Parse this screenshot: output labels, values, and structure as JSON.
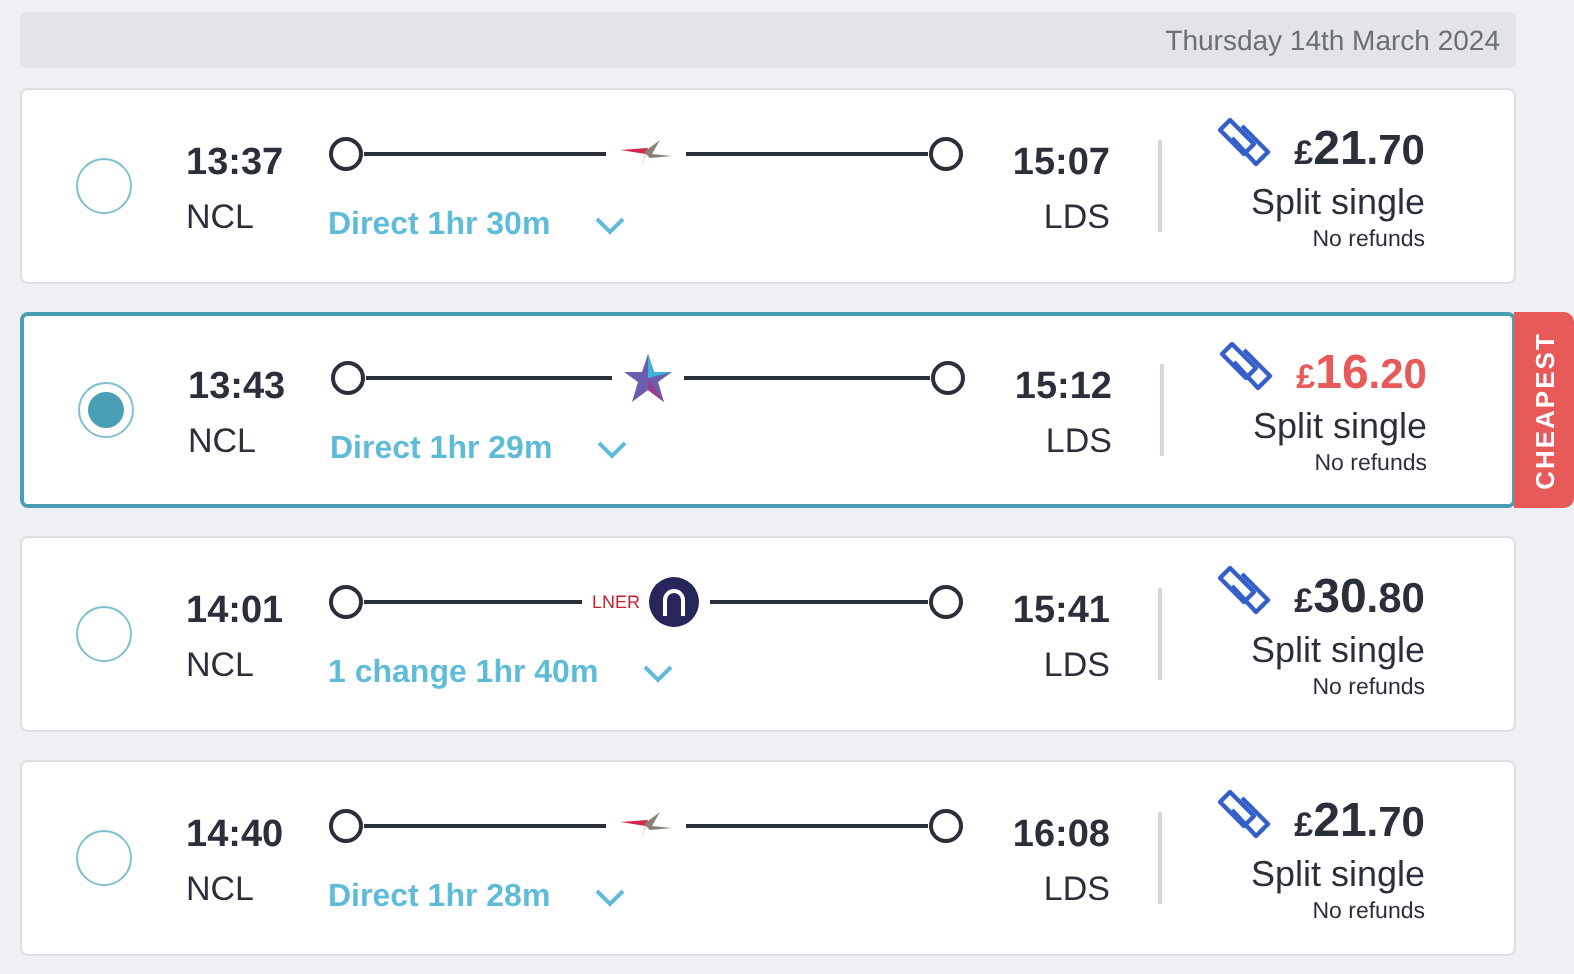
{
  "date": "Thursday 14th March 2024",
  "journeys": [
    {
      "selected": false,
      "cheapest": false,
      "depart": "13:37",
      "from": "NCL",
      "arrive": "15:07",
      "to": "LDS",
      "operator": {
        "kind": "bird"
      },
      "summary": "Direct 1hr 30m",
      "currency": "£",
      "pounds": "21",
      "pence": ".70",
      "fare": "Split single",
      "conditions": "No refunds"
    },
    {
      "selected": true,
      "cheapest": true,
      "badge": "CHEAPEST",
      "depart": "13:43",
      "from": "NCL",
      "arrive": "15:12",
      "to": "LDS",
      "operator": {
        "kind": "star"
      },
      "summary": "Direct 1hr 29m",
      "currency": "£",
      "pounds": "16",
      "pence": ".20",
      "fare": "Split single",
      "conditions": "No refunds"
    },
    {
      "selected": false,
      "cheapest": false,
      "depart": "14:01",
      "from": "NCL",
      "arrive": "15:41",
      "to": "LDS",
      "operator": {
        "kind": "lner",
        "label": "LNER"
      },
      "summary": "1 change 1hr 40m",
      "currency": "£",
      "pounds": "30",
      "pence": ".80",
      "fare": "Split single",
      "conditions": "No refunds"
    },
    {
      "selected": false,
      "cheapest": false,
      "depart": "14:40",
      "from": "NCL",
      "arrive": "16:08",
      "to": "LDS",
      "operator": {
        "kind": "bird"
      },
      "summary": "Direct 1hr 28m",
      "currency": "£",
      "pounds": "21",
      "pence": ".70",
      "fare": "Split single",
      "conditions": "No refunds"
    }
  ]
}
